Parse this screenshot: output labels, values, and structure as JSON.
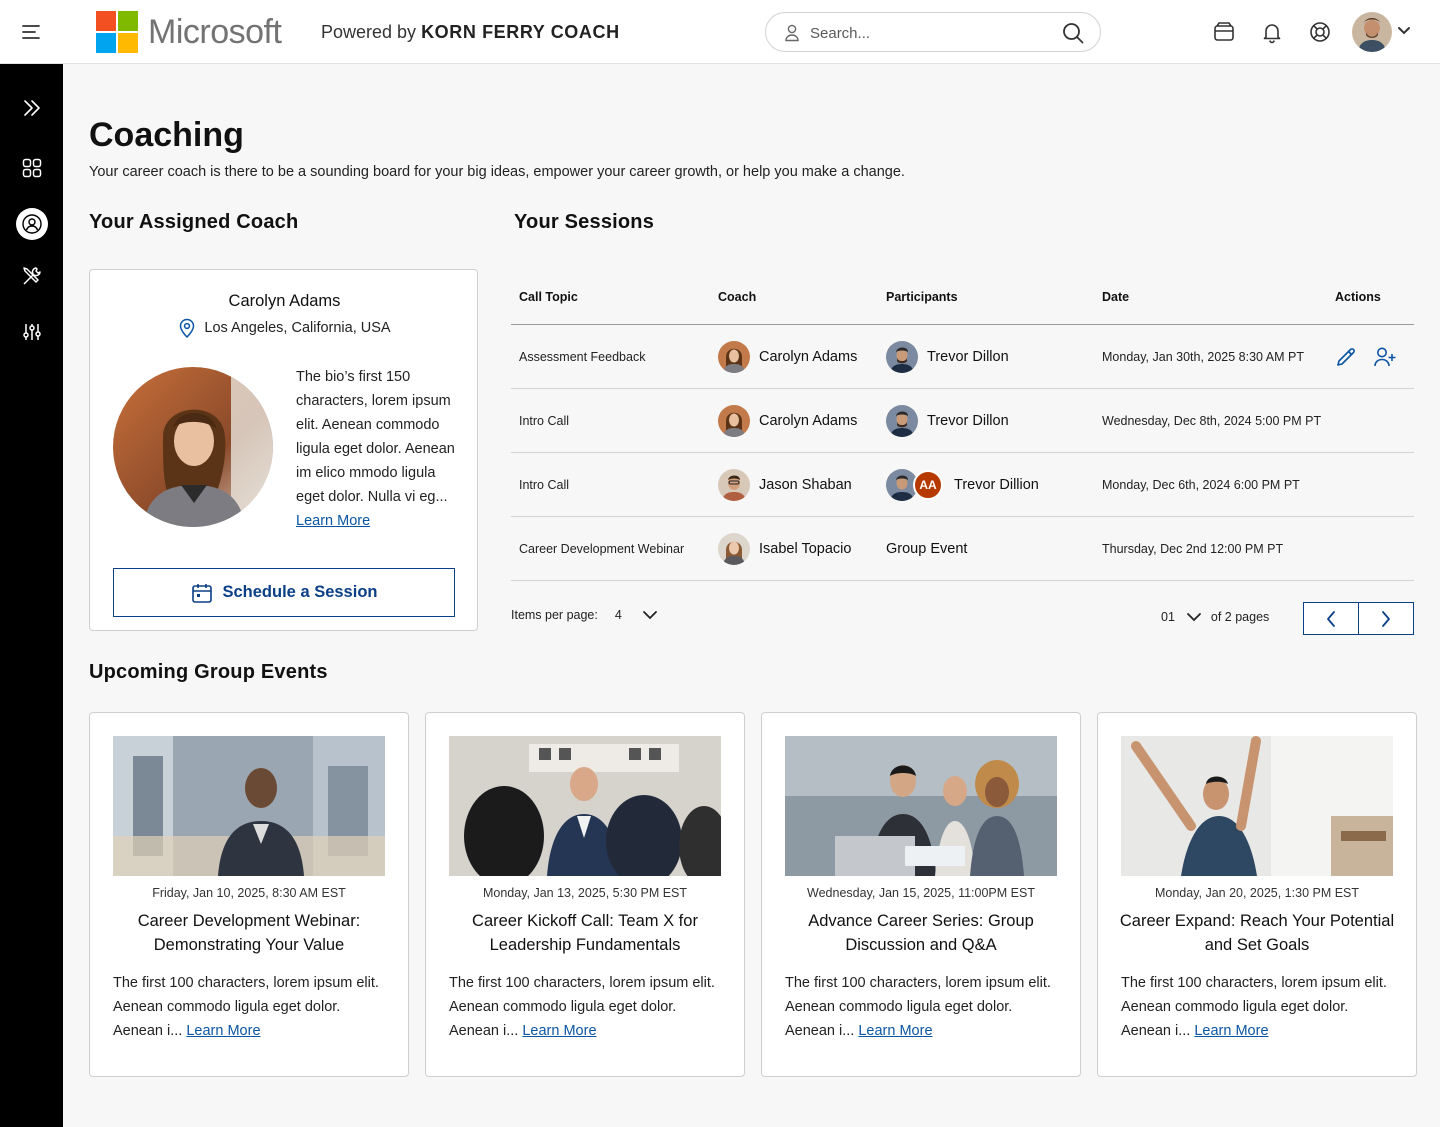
{
  "header": {
    "brand": "Microsoft",
    "powered_prefix": "Powered by",
    "powered_brand": "KORN FERRY COACH",
    "search_placeholder": "Search...",
    "logo_colors": [
      "#f25022",
      "#7fba00",
      "#00a4ef",
      "#ffb900"
    ]
  },
  "sidebar": {
    "icons": [
      "expand-icon",
      "dashboard-icon",
      "coaching-icon",
      "tools-icon",
      "settings-sliders-icon"
    ],
    "active": "coaching-icon"
  },
  "page": {
    "title": "Coaching",
    "subtitle": "Your career coach is there to be a sounding board for your big ideas, empower your career growth, or help you make a change."
  },
  "coach": {
    "section_title": "Your Assigned Coach",
    "name": "Carolyn Adams",
    "location": "Los Angeles, California, USA",
    "bio": "The bio’s first 150 characters, lorem ipsum elit. Aenean commodo ligula eget dolor. Aenean im elico mmodo ligula eget dolor. Nulla vi eg...",
    "learn_more": "Learn More",
    "schedule_label": "Schedule a Session"
  },
  "sessions": {
    "section_title": "Your Sessions",
    "columns": [
      "Call Topic",
      "Coach",
      "Participants",
      "Date",
      "Actions"
    ],
    "rows": [
      {
        "topic": "Assessment Feedback",
        "coach": "Carolyn Adams",
        "participant": "Trevor Dillon",
        "date": "Monday, Jan 30th, 2025 8:30 AM PT"
      },
      {
        "topic": "Intro Call",
        "coach": "Carolyn Adams",
        "participant": "Trevor Dillon",
        "date": "Wednesday, Dec 8th, 2024 5:00 PM PT"
      },
      {
        "topic": "Intro Call",
        "coach": "Jason Shaban",
        "participant": "Trevor Dillion",
        "participant_badge": "AA",
        "date": "Monday, Dec 6th, 2024 6:00 PM PT"
      },
      {
        "topic": "Career Development Webinar",
        "coach": "Isabel Topacio",
        "participant": "Group Event",
        "date": "Thursday, Dec 2nd 12:00 PM PT"
      }
    ],
    "items_per_page_label": "Items per page:",
    "items_per_page": "4",
    "current_page": "01",
    "of_pages": "of 2 pages"
  },
  "events": {
    "section_title": "Upcoming Group Events",
    "items": [
      {
        "date": "Friday, Jan 10, 2025, 8:30 AM EST",
        "title": "Career Development Webinar: Demonstrating Your Value",
        "desc": "The first 100 characters, lorem ipsum elit. Aenean commodo ligula eget dolor. Aenean i...",
        "link": "Learn More"
      },
      {
        "date": "Monday, Jan 13, 2025, 5:30 PM EST",
        "title": "Career Kickoff Call: Team X for Leadership Fundamentals",
        "desc": "The first 100 characters, lorem ipsum elit. Aenean commodo ligula eget dolor. Aenean i...",
        "link": "Learn More"
      },
      {
        "date": "Wednesday, Jan 15, 2025, 11:00PM EST",
        "title": "Advance Career Series: Group Discussion and Q&A",
        "desc": "The first 100 characters, lorem ipsum elit. Aenean commodo ligula eget dolor. Aenean i...",
        "link": "Learn More"
      },
      {
        "date": "Monday, Jan 20, 2025, 1:30 PM EST",
        "title": "Career Expand: Reach Your Potential and Set Goals",
        "desc": "The first 100 characters, lorem ipsum elit. Aenean commodo ligula eget dolor. Aenean i...",
        "link": "Learn More"
      }
    ]
  },
  "colors": {
    "accent": "#0b3f86",
    "link": "#0b55a3",
    "badge": "#b63a00"
  }
}
